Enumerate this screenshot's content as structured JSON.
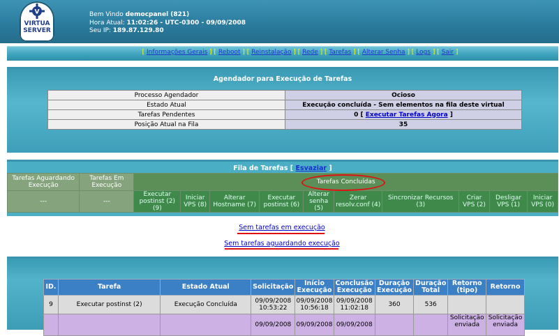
{
  "header": {
    "logo_text_1": "VIRTUA",
    "logo_text_2": "SERVER",
    "welcome_prefix": "Bem Vindo ",
    "welcome_user": "democpanel (821)",
    "time_prefix": "Hora Atual: ",
    "time_value": "11:02:26 - UTC-0300 - 09/09/2008",
    "ip_prefix": "Seu IP: ",
    "ip_value": "189.87.129.80"
  },
  "nav": {
    "items": [
      "Informações Gerais",
      "Reboot",
      "Reinstalação",
      "Rede",
      "Tarefas",
      "Alterar Senha",
      "Logs",
      "Sair"
    ]
  },
  "scheduler": {
    "title": "Agendador para Execução de Tarefas",
    "rows": [
      {
        "label": "Processo Agendador",
        "value": "Ocioso"
      },
      {
        "label": "Estado Atual",
        "value": "Execução concluída - Sem elementos na fila deste virtual"
      },
      {
        "label": "Tarefas Pendentes",
        "value_prefix": "0 [ ",
        "value_link": "Executar Tarefas Agora",
        "value_suffix": " ]"
      },
      {
        "label": "Posição Atual na Fila",
        "value": "35"
      }
    ]
  },
  "queue": {
    "title_prefix": "Fila de Tarefas [ ",
    "title_link": "Esvaziar",
    "title_suffix": " ]",
    "col_waiting": "Tarefas Aguardando Execução",
    "col_running": "Tarefas Em Execução",
    "col_done": "Tarefas Concluídas",
    "waiting_value": "---",
    "running_value": "---",
    "done_items": [
      "Executar postinst (2) (9)",
      "Iniciar VPS (8)",
      "Alterar Hostname (7)",
      "Executar postinst (6)",
      "Alterar senha (5)",
      "Zerar resolv.conf (4)",
      "Sincronizar Recursos (3)",
      "Criar VPS (2)",
      "Desligar VPS (1)",
      "Iniciar VPS (0)"
    ]
  },
  "status_links": {
    "no_running": "Sem tarefas em execução",
    "no_waiting": "Sem tarefas aguardando execução"
  },
  "history": {
    "headers": [
      "ID.",
      "Tarefa",
      "Estado Atual",
      "Solicitação",
      "Início Execução",
      "Conclusão Execução",
      "Duração Execução",
      "Duração Total",
      "Retorno (tipo)",
      "Retorno"
    ],
    "row1": {
      "id": "9",
      "task": "Executar postinst (2)",
      "state": "Execução Concluída",
      "requested": "09/09/2008 10:53:22",
      "started": "09/09/2008 10:56:18",
      "finished": "09/09/2008 11:02:18",
      "exec_duration": "360",
      "total_duration": "536",
      "ret_type": "",
      "ret": ""
    },
    "row2": {
      "requested": "09/09/2008",
      "started": "09/09/2008",
      "finished": "09/09/2008",
      "ret_type": "Solicitação enviada",
      "ret": "Solicitação enviada"
    }
  },
  "colors": {
    "header_bg": "#2a7a9c",
    "panel_bg": "#44a8c2",
    "highlight_red": "#e01010",
    "link_blue": "#0000cc"
  }
}
